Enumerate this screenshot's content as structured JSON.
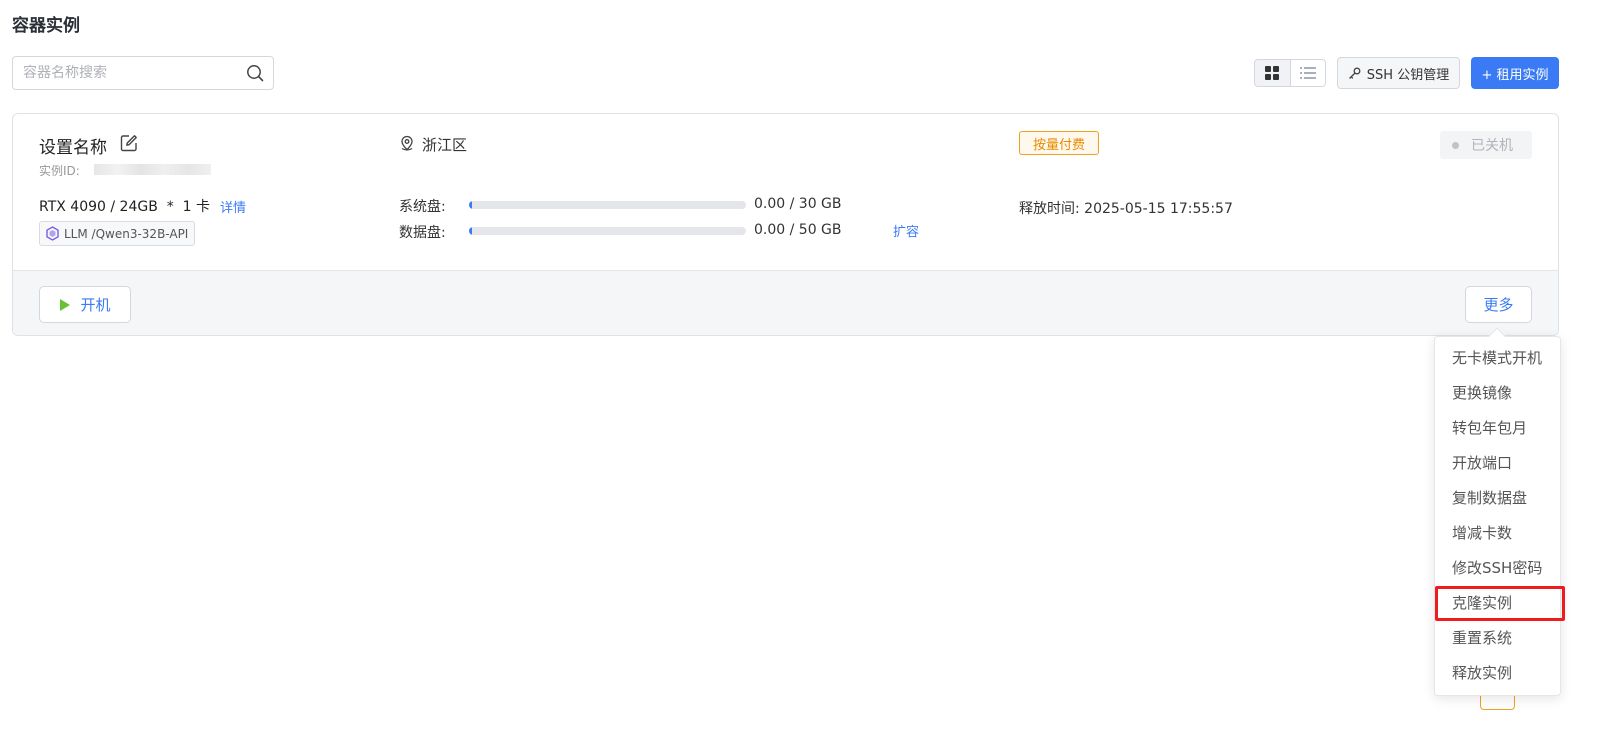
{
  "page": {
    "title": "容器实例"
  },
  "search": {
    "placeholder": "容器名称搜索",
    "value": "",
    "icon": "search-icon"
  },
  "toolbar": {
    "view_modes": [
      "grid-view-icon",
      "list-view-icon"
    ],
    "active_view": "grid",
    "ssh_label": "SSH 公钥管理",
    "rent_label": "+ 租用实例"
  },
  "instance": {
    "name": "设置名称",
    "id_label": "实例ID:",
    "gpu": "RTX 4090 / 24GB  *  1 卡",
    "details_label": "详情",
    "image": "LLM /Qwen3-32B-API",
    "region": "浙江区",
    "disks": [
      {
        "label": "系统盘:",
        "used_fraction": 0.0,
        "value": "0.00 / 30 GB"
      },
      {
        "label": "数据盘:",
        "used_fraction": 0.0,
        "value": "0.00 / 50 GB"
      }
    ],
    "expand_label": "扩容",
    "billing": "按量付费",
    "release_time": "释放时间: 2025-05-15 17:55:57",
    "status": "已关机"
  },
  "actions": {
    "start_label": "开机",
    "more_label": "更多"
  },
  "more_menu": {
    "items": [
      "无卡模式开机",
      "更换镜像",
      "转包年包月",
      "开放端口",
      "复制数据盘",
      "增减卡数",
      "修改SSH密码",
      "克隆实例",
      "重置系统",
      "释放实例"
    ],
    "highlighted": "克隆实例"
  },
  "colors": {
    "accent": "#3a7bf5",
    "billing": "#e88b00",
    "highlight": "#ee1c1c",
    "play": "#67c23a"
  }
}
